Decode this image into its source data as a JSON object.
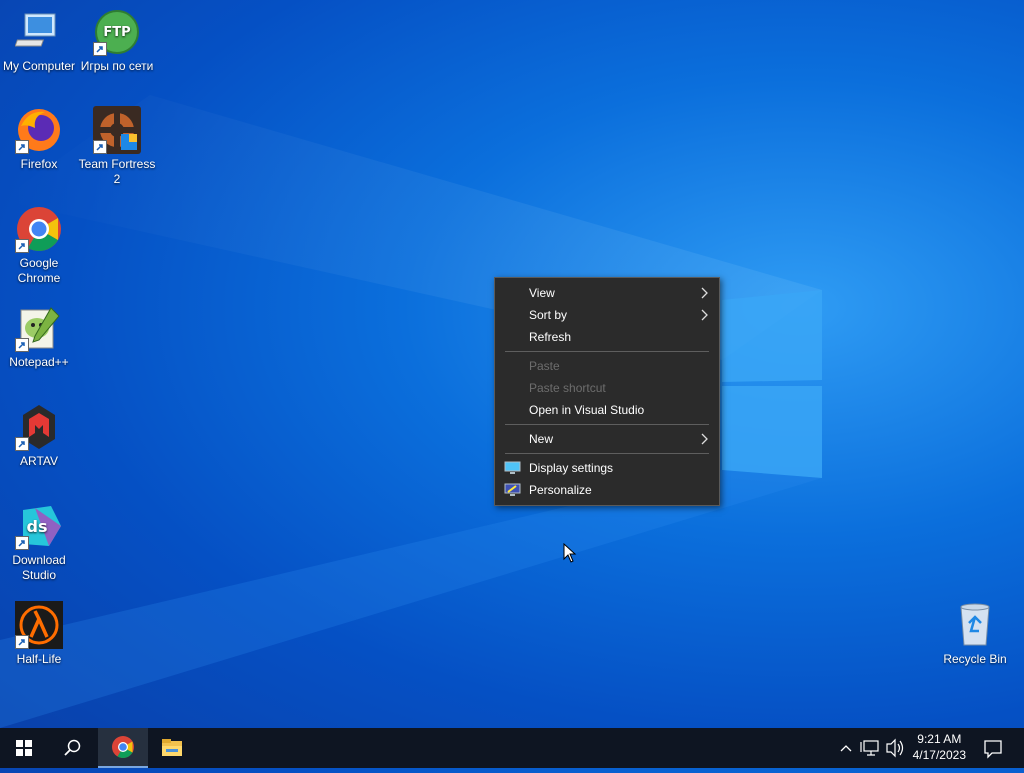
{
  "desktop": {
    "icons": [
      {
        "label": "My Computer",
        "icon": "computer-icon"
      },
      {
        "label": "Игры по сети",
        "icon": "ftp-icon",
        "badge": "FTP"
      },
      {
        "label": "Firefox",
        "icon": "firefox-icon"
      },
      {
        "label": "Team Fortress 2",
        "icon": "team-fortress-icon"
      },
      {
        "label": "Google Chrome",
        "icon": "chrome-icon"
      },
      {
        "label": "Notepad++",
        "icon": "notepad-plus-plus-icon"
      },
      {
        "label": "ARTAV",
        "icon": "artav-icon"
      },
      {
        "label": "Download Studio",
        "icon": "download-studio-icon",
        "badge": "ds"
      },
      {
        "label": "Half-Life",
        "icon": "half-life-icon"
      },
      {
        "label": "Recycle Bin",
        "icon": "recycle-bin-icon"
      }
    ]
  },
  "context_menu": {
    "items": [
      {
        "label": "View",
        "submenu": true,
        "enabled": true
      },
      {
        "label": "Sort by",
        "submenu": true,
        "enabled": true
      },
      {
        "label": "Refresh",
        "enabled": true
      },
      {
        "label": "Paste",
        "enabled": false
      },
      {
        "label": "Paste shortcut",
        "enabled": false
      },
      {
        "label": "Open in Visual Studio",
        "enabled": true
      },
      {
        "label": "New",
        "submenu": true,
        "enabled": true
      },
      {
        "label": "Display settings",
        "enabled": true,
        "icon": "display-settings-icon"
      },
      {
        "label": "Personalize",
        "enabled": true,
        "icon": "personalize-icon"
      }
    ]
  },
  "taskbar": {
    "start": "windows-start-icon",
    "search": "search-icon",
    "pinned": [
      "chrome-icon",
      "file-explorer-icon"
    ],
    "tray": [
      "chevron-up-icon",
      "network-icon",
      "volume-icon"
    ],
    "clock": {
      "time": "9:21 AM",
      "date": "4/17/2023"
    },
    "notifications": "action-center-icon"
  },
  "colors": {
    "accent": "#0a6fdc",
    "menu_bg": "#2b2b2b",
    "taskbar_bg": "#0e1522"
  }
}
